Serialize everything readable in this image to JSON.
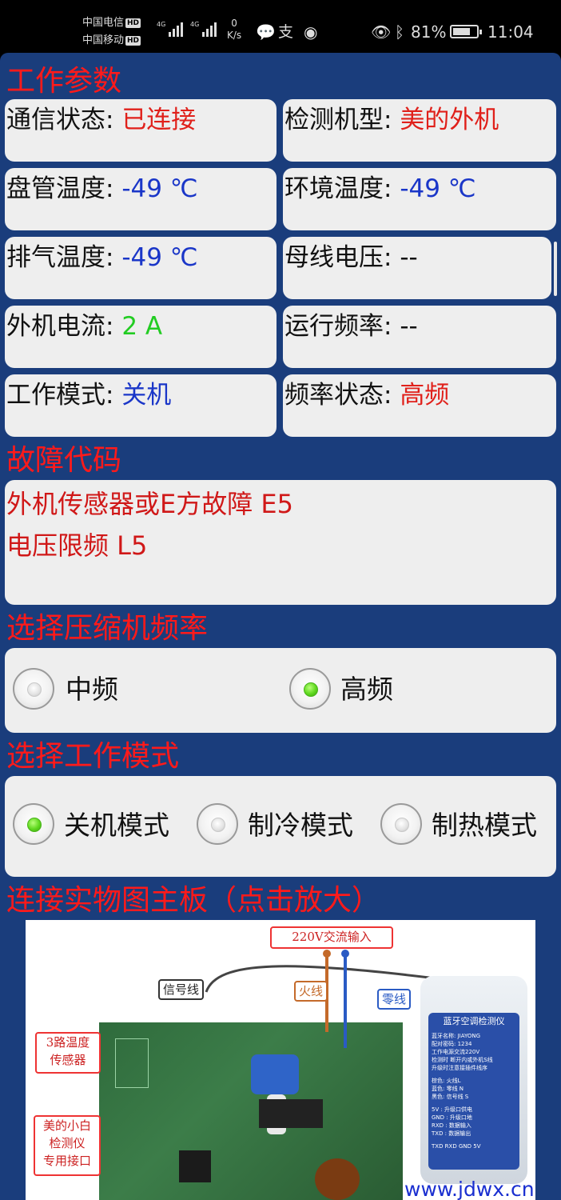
{
  "status_bar": {
    "carrier_1": "中国电信",
    "carrier_2": "中国移动",
    "hd_badge": "HD",
    "net_1": "4G",
    "net_2": "4G",
    "speed_value": "0",
    "speed_unit": "K/s",
    "battery_percent": "81%",
    "battery_level": 0.81,
    "time": "11:04"
  },
  "sections": {
    "work_params": "工作参数",
    "fault_code": "故障代码",
    "compressor_freq": "选择压缩机频率",
    "work_mode": "选择工作模式",
    "board_photo": "连接实物图主板（点击放大）"
  },
  "params": [
    {
      "label": "通信状态: ",
      "value": "已连接",
      "color": "red"
    },
    {
      "label": "检测机型: ",
      "value": "美的外机",
      "color": "red"
    },
    {
      "label": "盘管温度: ",
      "value": "-49 ℃",
      "color": "blue"
    },
    {
      "label": "环境温度: ",
      "value": "-49 ℃",
      "color": "blue"
    },
    {
      "label": "排气温度: ",
      "value": "-49 ℃",
      "color": "blue"
    },
    {
      "label": "母线电压: ",
      "value": "--",
      "color": "black"
    },
    {
      "label": "外机电流: ",
      "value": "2 A",
      "color": "green"
    },
    {
      "label": "运行频率: ",
      "value": "--",
      "color": "black"
    },
    {
      "label": "工作模式: ",
      "value": "关机",
      "color": "blue"
    },
    {
      "label": "频率状态: ",
      "value": "高频",
      "color": "red"
    }
  ],
  "faults": [
    "外机传感器或E方故障 E5",
    "电压限频 L5"
  ],
  "freq_options": [
    {
      "label": "中频",
      "selected": false
    },
    {
      "label": "高频",
      "selected": true
    }
  ],
  "mode_options": [
    {
      "label": "关机模式",
      "selected": true
    },
    {
      "label": "制冷模式",
      "selected": false
    },
    {
      "label": "制热模式",
      "selected": false
    }
  ],
  "board_image": {
    "label_220v": "220V交流输入",
    "label_signal": "信号线",
    "label_live": "火线",
    "label_neutral": "零线",
    "label_sensor_1": "3路温度",
    "label_sensor_2": "传感器",
    "label_port_1": "美的小白",
    "label_port_2": "检测仪",
    "label_port_3": "专用接口",
    "device_title": "蓝牙空调检测仪",
    "device_line_1": "蓝牙名称: JIAYONG",
    "device_line_2": "配对密码: 1234",
    "device_line_3": "工作电源交流220V",
    "device_line_4": "检测时 断开内或外机S线",
    "device_line_5": "升级时注意接插件线序",
    "device_line_6": "棕色: 火线L",
    "device_line_7": "蓝色: 零线 N",
    "device_line_8": "黑色: 信号线 S",
    "device_line_9": "5V : 升级口供电",
    "device_line_10": "GND : 升级口地",
    "device_line_11": "RXD : 数据输入",
    "device_line_12": "TXD : 数据输出",
    "device_line_13": "TXD RXD GND 5V",
    "watermark": "www.jdwx.cn"
  }
}
